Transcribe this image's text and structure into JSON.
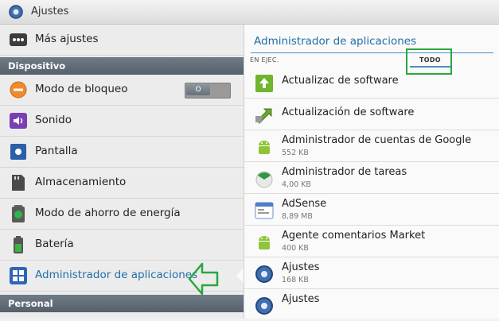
{
  "actionbar": {
    "title": "Ajustes",
    "icon": "gear-icon"
  },
  "left": {
    "more_settings": {
      "label": "Más ajustes",
      "icon": "more-dots-icon"
    },
    "section_device": "Dispositivo",
    "items": [
      {
        "label": "Modo de bloqueo",
        "icon": "block-icon",
        "toggle": "O"
      },
      {
        "label": "Sonido",
        "icon": "speaker-icon"
      },
      {
        "label": "Pantalla",
        "icon": "display-icon"
      },
      {
        "label": "Almacenamiento",
        "icon": "storage-icon"
      },
      {
        "label": "Modo de ahorro de energía",
        "icon": "recycle-icon"
      },
      {
        "label": "Batería",
        "icon": "battery-icon"
      },
      {
        "label": "Administrador de aplicaciones",
        "icon": "apps-grid-icon"
      }
    ],
    "section_personal": "Personal"
  },
  "right": {
    "title": "Administrador de aplicaciones",
    "tabs": {
      "running": "EN EJEC.",
      "all": "TODO"
    },
    "apps": [
      {
        "name": "Actualizac de software",
        "size": "",
        "icon": "software-update-icon"
      },
      {
        "name": "Actualización de software",
        "size": "",
        "icon": "update-arrow-icon"
      },
      {
        "name": "Administrador de cuentas de Google",
        "size": "552 KB",
        "icon": "android-icon"
      },
      {
        "name": "Administrador de tareas",
        "size": "4,00 KB",
        "icon": "task-manager-icon"
      },
      {
        "name": "AdSense",
        "size": "8,89 MB",
        "icon": "adsense-icon"
      },
      {
        "name": "Agente comentarios Market",
        "size": "400 KB",
        "icon": "android-icon"
      },
      {
        "name": "Ajustes",
        "size": "168 KB",
        "icon": "gear-icon"
      },
      {
        "name": "Ajustes",
        "size": "",
        "icon": "gear-icon"
      }
    ]
  },
  "colors": {
    "accent": "#1f6fa8",
    "highlight": "#2aa640",
    "section": "#5f6a75"
  }
}
